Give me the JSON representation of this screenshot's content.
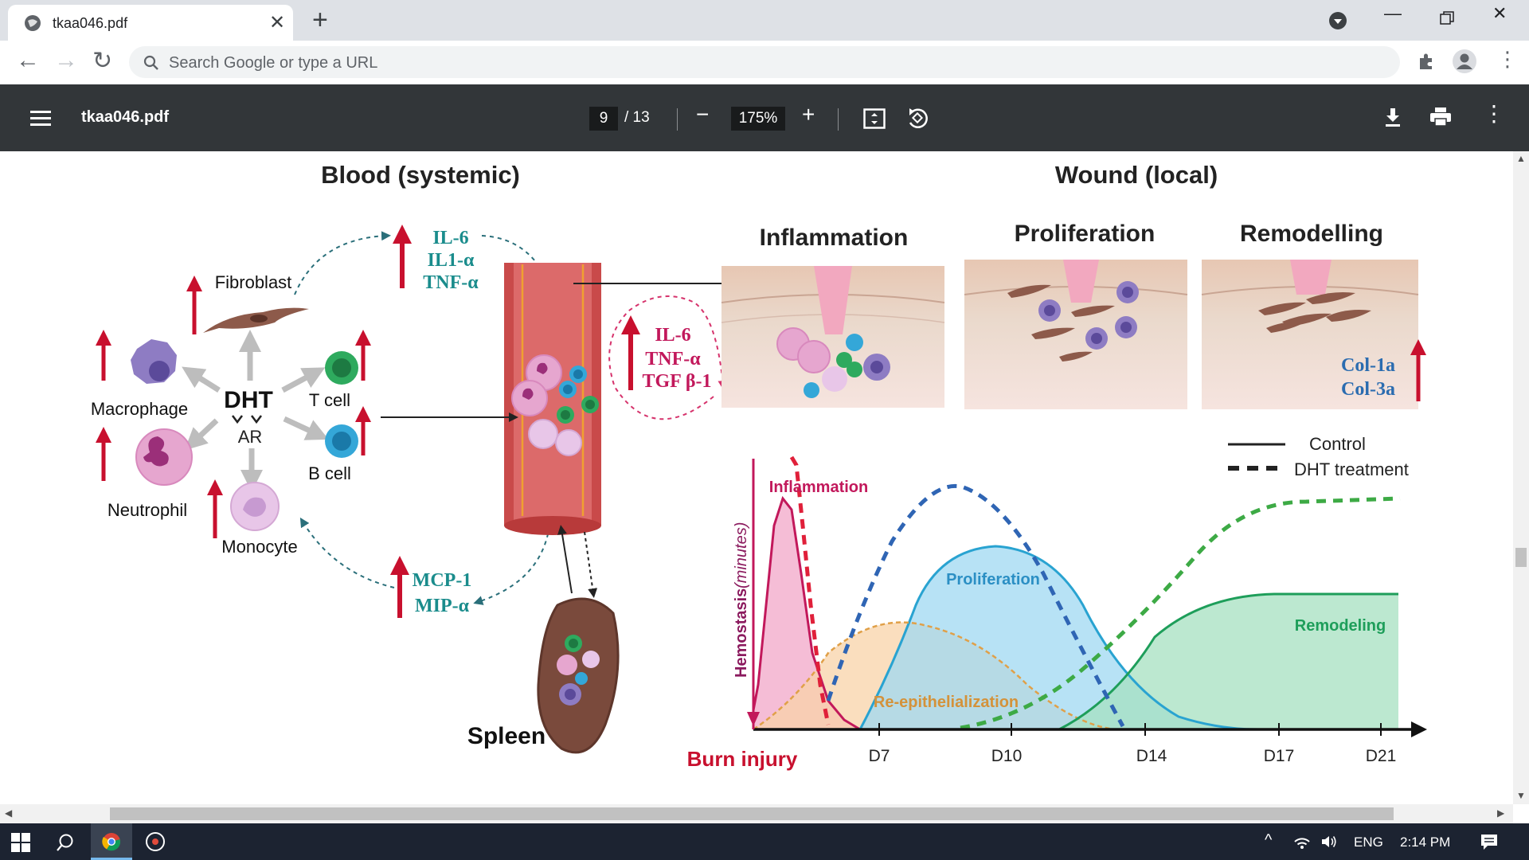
{
  "browser": {
    "tab_title": "tkaa046.pdf",
    "new_tab_label": "+",
    "omnibox_placeholder": "Search Google or type a URL"
  },
  "pdf_toolbar": {
    "file_name": "tkaa046.pdf",
    "current_page": "9",
    "total_pages": "/ 13",
    "zoom": "175%"
  },
  "figure": {
    "blood_title": "Blood (systemic)",
    "wound_title": "Wound (local)",
    "cells": {
      "fibroblast": "Fibroblast",
      "macrophage": "Macrophage",
      "neutrophil": "Neutrophil",
      "monocyte": "Monocyte",
      "t_cell": "T cell",
      "b_cell": "B cell",
      "dht": "DHT",
      "ar": "AR",
      "spleen": "Spleen"
    },
    "cytokines_top": [
      "IL-6",
      "IL1-α",
      "TNF-α"
    ],
    "cytokines_wound": [
      "IL-6",
      "TNF-α",
      "TGF β-1"
    ],
    "chemokines": [
      "MCP-1",
      "MIP-α"
    ],
    "stages": {
      "inflammation": "Inflammation",
      "proliferation": "Proliferation",
      "remodelling": "Remodelling"
    },
    "collagen": [
      "Col-1a",
      "Col-3a"
    ],
    "colors": {
      "arrow_red": "#c8102e",
      "teal_text": "#1a8c8c",
      "magenta_text": "#c2185b",
      "inflammation_pink": "#f4b6d2",
      "proliferation_blue": "#9fd8f2",
      "reepi_orange": "#f8d3a8",
      "remodel_green": "#a6e0c0"
    }
  },
  "chart_data": {
    "type": "area",
    "legend": [
      "Control",
      "DHT treatment"
    ],
    "legend_position": "top-right",
    "x_ticks": [
      "D7",
      "D10",
      "D14",
      "D17",
      "D21"
    ],
    "x_start_label": "Burn injury",
    "ylabel_bold": "Hemostasis",
    "ylabel_italic": "(minutes)",
    "series": [
      {
        "name": "Inflammation",
        "style": "control",
        "color": "#c2185b"
      },
      {
        "name": "Proliferation",
        "style": "control",
        "color": "#29a3d1"
      },
      {
        "name": "Re-epithelialization",
        "style": "control",
        "color": "#e0a048"
      },
      {
        "name": "Remodeling",
        "style": "control",
        "color": "#1e9e5a"
      }
    ]
  },
  "taskbar": {
    "language": "ENG",
    "time": "2:14 PM"
  }
}
